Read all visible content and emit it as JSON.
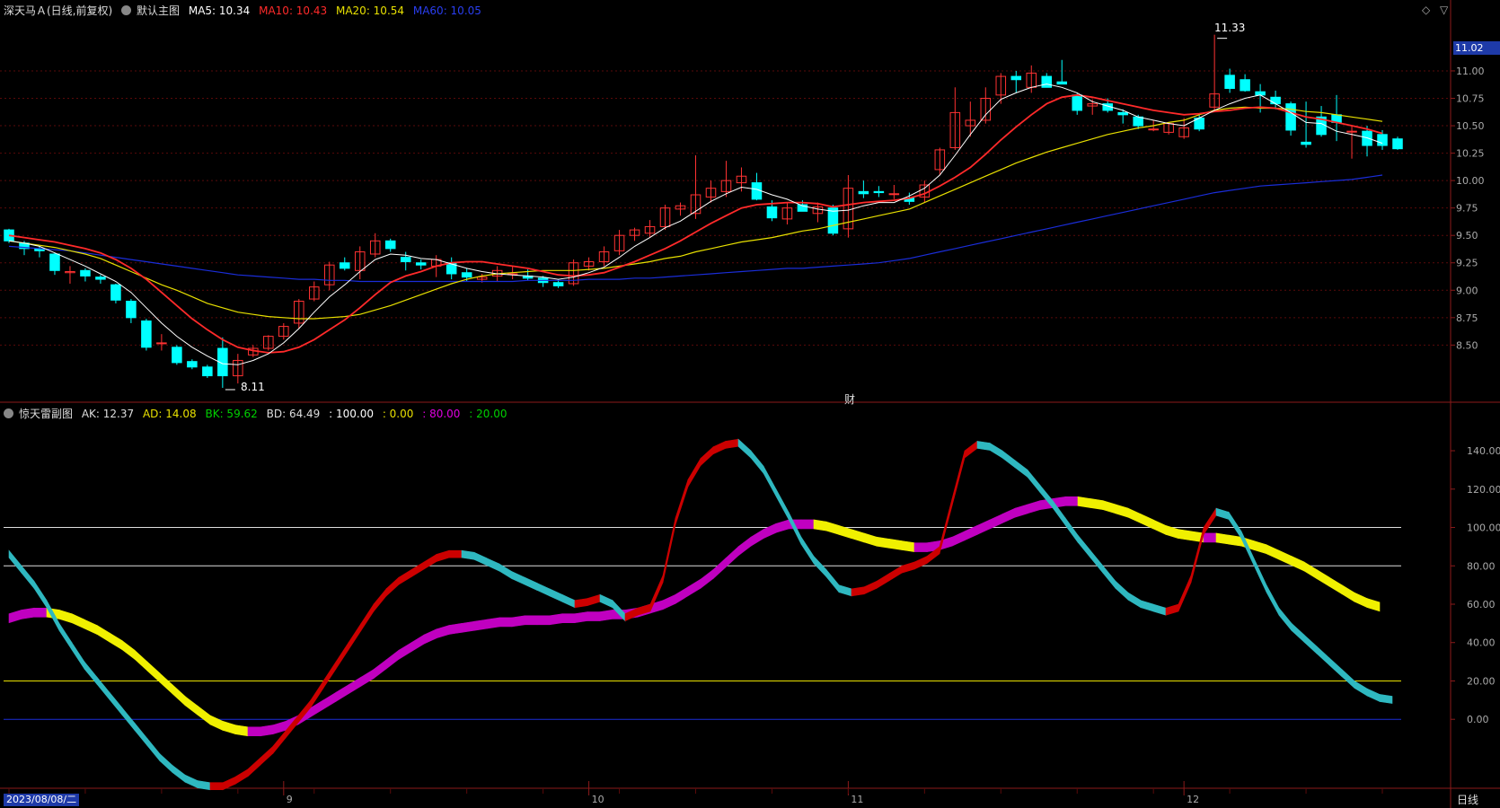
{
  "main_header": {
    "title": "深天马Ａ(日线,前复权)",
    "main_label": "默认主图",
    "ma5": "MA5: 10.34",
    "ma10": "MA10: 10.43",
    "ma20": "MA20: 10.54",
    "ma60": "MA60: 10.05"
  },
  "sub_header": {
    "title": "惊天雷副图",
    "ak": "AK: 12.37",
    "ad": "AD: 14.08",
    "bk": "BK: 59.62",
    "bd": "BD: 64.49",
    "l100": ": 100.00",
    "l0": ": 0.00",
    "l80": ": 80.00",
    "l20": ": 20.00"
  },
  "colors": {
    "up": "#ff3232",
    "down": "#00ffff",
    "ma5": "#ffffff",
    "ma10": "#ff2a2a",
    "ma20": "#e8e000",
    "ma60": "#1a2dd8",
    "ak_up": "#cc0000",
    "ak_down": "#2fb8c0",
    "ad_up": "#c000c0",
    "ad_down": "#f0f000"
  },
  "markers": {
    "high": "11.33",
    "low": "8.11",
    "fin": "财"
  },
  "price_tag": "11.02",
  "date_tag": "2023/08/08/二",
  "period_label": "日线",
  "window_controls": [
    "◇",
    "▽"
  ],
  "chart_data": [
    {
      "type": "candlestick",
      "y_ticks": [
        "11.00",
        "10.75",
        "10.50",
        "10.25",
        "10.00",
        "9.75",
        "9.50",
        "9.25",
        "9.00",
        "8.75",
        "8.50"
      ],
      "ylim": [
        8.11,
        11.45
      ],
      "x_ticks": [
        {
          "label": "9",
          "index": 18
        },
        {
          "label": "10",
          "index": 38
        },
        {
          "label": "11",
          "index": 55
        },
        {
          "label": "12",
          "index": 77
        }
      ],
      "ohlc": [
        [
          9.55,
          9.56,
          9.43,
          9.45
        ],
        [
          9.43,
          9.45,
          9.32,
          9.38
        ],
        [
          9.38,
          9.4,
          9.3,
          9.36
        ],
        [
          9.33,
          9.34,
          9.14,
          9.18
        ],
        [
          9.16,
          9.22,
          9.06,
          9.17
        ],
        [
          9.18,
          9.2,
          9.08,
          9.13
        ],
        [
          9.12,
          9.14,
          9.06,
          9.1
        ],
        [
          9.05,
          9.06,
          8.88,
          8.91
        ],
        [
          8.9,
          8.92,
          8.7,
          8.75
        ],
        [
          8.72,
          8.74,
          8.45,
          8.48
        ],
        [
          8.52,
          8.6,
          8.45,
          8.52
        ],
        [
          8.48,
          8.5,
          8.32,
          8.34
        ],
        [
          8.35,
          8.37,
          8.28,
          8.3
        ],
        [
          8.3,
          8.32,
          8.2,
          8.22
        ],
        [
          8.47,
          8.57,
          8.11,
          8.22
        ],
        [
          8.22,
          8.42,
          8.15,
          8.36
        ],
        [
          8.41,
          8.5,
          8.39,
          8.47
        ],
        [
          8.47,
          8.59,
          8.45,
          8.58
        ],
        [
          8.58,
          8.7,
          8.55,
          8.67
        ],
        [
          8.7,
          8.92,
          8.65,
          8.9
        ],
        [
          8.92,
          9.08,
          8.9,
          9.03
        ],
        [
          9.05,
          9.26,
          9.0,
          9.23
        ],
        [
          9.25,
          9.3,
          9.18,
          9.2
        ],
        [
          9.18,
          9.4,
          9.1,
          9.35
        ],
        [
          9.33,
          9.52,
          9.3,
          9.45
        ],
        [
          9.45,
          9.47,
          9.35,
          9.38
        ],
        [
          9.3,
          9.35,
          9.18,
          9.26
        ],
        [
          9.25,
          9.28,
          9.19,
          9.23
        ],
        [
          9.22,
          9.32,
          9.12,
          9.28
        ],
        [
          9.25,
          9.3,
          9.1,
          9.15
        ],
        [
          9.16,
          9.2,
          9.08,
          9.12
        ],
        [
          9.1,
          9.15,
          9.07,
          9.12
        ],
        [
          9.13,
          9.22,
          9.08,
          9.18
        ],
        [
          9.15,
          9.22,
          9.1,
          9.15
        ],
        [
          9.13,
          9.19,
          9.09,
          9.11
        ],
        [
          9.11,
          9.13,
          9.03,
          9.07
        ],
        [
          9.07,
          9.1,
          9.02,
          9.04
        ],
        [
          9.06,
          9.28,
          9.04,
          9.25
        ],
        [
          9.22,
          9.3,
          9.18,
          9.26
        ],
        [
          9.26,
          9.4,
          9.22,
          9.35
        ],
        [
          9.36,
          9.55,
          9.32,
          9.5
        ],
        [
          9.5,
          9.57,
          9.45,
          9.55
        ],
        [
          9.52,
          9.64,
          9.48,
          9.58
        ],
        [
          9.58,
          9.78,
          9.55,
          9.75
        ],
        [
          9.74,
          9.8,
          9.68,
          9.77
        ],
        [
          9.7,
          10.23,
          9.65,
          9.87
        ],
        [
          9.85,
          10.0,
          9.8,
          9.93
        ],
        [
          9.9,
          10.18,
          9.85,
          10.0
        ],
        [
          9.98,
          10.12,
          9.9,
          10.04
        ],
        [
          9.98,
          10.07,
          9.82,
          9.83
        ],
        [
          9.76,
          9.82,
          9.63,
          9.66
        ],
        [
          9.65,
          9.8,
          9.6,
          9.75
        ],
        [
          9.78,
          9.82,
          9.72,
          9.72
        ],
        [
          9.7,
          9.8,
          9.62,
          9.76
        ],
        [
          9.75,
          9.78,
          9.5,
          9.52
        ],
        [
          9.56,
          10.05,
          9.48,
          9.93
        ],
        [
          9.9,
          10.0,
          9.84,
          9.88
        ],
        [
          9.9,
          9.95,
          9.85,
          9.89
        ],
        [
          9.88,
          9.96,
          9.83,
          9.88
        ],
        [
          9.84,
          9.89,
          9.78,
          9.81
        ],
        [
          9.85,
          10.0,
          9.8,
          9.96
        ],
        [
          10.1,
          10.3,
          10.05,
          10.28
        ],
        [
          10.3,
          10.85,
          10.28,
          10.62
        ],
        [
          10.5,
          10.72,
          10.4,
          10.55
        ],
        [
          10.55,
          10.85,
          10.52,
          10.75
        ],
        [
          10.78,
          10.98,
          10.7,
          10.95
        ],
        [
          10.95,
          11.0,
          10.8,
          10.92
        ],
        [
          10.85,
          11.05,
          10.8,
          10.98
        ],
        [
          10.95,
          10.98,
          10.85,
          10.85
        ],
        [
          10.9,
          11.1,
          10.88,
          10.88
        ],
        [
          10.78,
          10.8,
          10.6,
          10.64
        ],
        [
          10.68,
          10.74,
          10.6,
          10.7
        ],
        [
          10.7,
          10.75,
          10.62,
          10.64
        ],
        [
          10.62,
          10.65,
          10.52,
          10.6
        ],
        [
          10.58,
          10.6,
          10.47,
          10.5
        ],
        [
          10.47,
          10.55,
          10.45,
          10.47
        ],
        [
          10.44,
          10.52,
          10.42,
          10.52
        ],
        [
          10.4,
          10.57,
          10.38,
          10.48
        ],
        [
          10.57,
          10.6,
          10.45,
          10.47
        ],
        [
          10.67,
          11.33,
          10.63,
          10.79
        ],
        [
          10.96,
          11.02,
          10.8,
          10.84
        ],
        [
          10.92,
          10.97,
          10.81,
          10.82
        ],
        [
          10.81,
          10.88,
          10.62,
          10.78
        ],
        [
          10.76,
          10.82,
          10.65,
          10.7
        ],
        [
          10.7,
          10.72,
          10.41,
          10.46
        ],
        [
          10.35,
          10.72,
          10.3,
          10.33
        ],
        [
          10.58,
          10.68,
          10.4,
          10.42
        ],
        [
          10.6,
          10.78,
          10.36,
          10.53
        ],
        [
          10.45,
          10.5,
          10.2,
          10.45
        ],
        [
          10.45,
          10.5,
          10.22,
          10.32
        ],
        [
          10.42,
          10.46,
          10.28,
          10.32
        ],
        [
          10.38,
          10.4,
          10.28,
          10.29
        ]
      ],
      "ma5": [
        9.45,
        9.43,
        9.4,
        9.34,
        9.28,
        9.22,
        9.15,
        9.08,
        8.98,
        8.84,
        8.7,
        8.58,
        8.48,
        8.4,
        8.33,
        8.32,
        8.36,
        8.42,
        8.52,
        8.65,
        8.8,
        8.94,
        9.05,
        9.17,
        9.28,
        9.33,
        9.32,
        9.29,
        9.28,
        9.24,
        9.2,
        9.17,
        9.15,
        9.14,
        9.13,
        9.12,
        9.1,
        9.12,
        9.16,
        9.21,
        9.3,
        9.4,
        9.48,
        9.57,
        9.63,
        9.72,
        9.81,
        9.88,
        9.94,
        9.92,
        9.87,
        9.83,
        9.77,
        9.74,
        9.72,
        9.73,
        9.77,
        9.8,
        9.8,
        9.86,
        9.93,
        10.05,
        10.23,
        10.42,
        10.6,
        10.74,
        10.8,
        10.85,
        10.88,
        10.85,
        10.8,
        10.72,
        10.68,
        10.64,
        10.58,
        10.55,
        10.52,
        10.5,
        10.57,
        10.64,
        10.7,
        10.75,
        10.78,
        10.7,
        10.62,
        10.53,
        10.52,
        10.45,
        10.42,
        10.39,
        10.34
      ],
      "ma10": [
        9.5,
        9.48,
        9.46,
        9.44,
        9.41,
        9.38,
        9.34,
        9.28,
        9.2,
        9.1,
        8.98,
        8.86,
        8.74,
        8.64,
        8.55,
        8.48,
        8.45,
        8.43,
        8.44,
        8.48,
        8.55,
        8.64,
        8.73,
        8.84,
        8.96,
        9.07,
        9.13,
        9.17,
        9.22,
        9.25,
        9.26,
        9.26,
        9.24,
        9.22,
        9.2,
        9.17,
        9.14,
        9.13,
        9.14,
        9.16,
        9.21,
        9.26,
        9.32,
        9.38,
        9.45,
        9.53,
        9.61,
        9.68,
        9.75,
        9.78,
        9.79,
        9.8,
        9.8,
        9.79,
        9.76,
        9.78,
        9.8,
        9.81,
        9.82,
        9.84,
        9.88,
        9.95,
        10.03,
        10.12,
        10.24,
        10.37,
        10.49,
        10.6,
        10.7,
        10.76,
        10.78,
        10.76,
        10.73,
        10.7,
        10.67,
        10.64,
        10.62,
        10.6,
        10.61,
        10.63,
        10.64,
        10.66,
        10.67,
        10.66,
        10.62,
        10.58,
        10.56,
        10.53,
        10.5,
        10.47,
        10.43
      ],
      "ma20": [
        9.45,
        9.43,
        9.41,
        9.39,
        9.36,
        9.33,
        9.29,
        9.23,
        9.17,
        9.11,
        9.05,
        9.0,
        8.94,
        8.88,
        8.84,
        8.8,
        8.78,
        8.76,
        8.75,
        8.74,
        8.74,
        8.75,
        8.76,
        8.78,
        8.82,
        8.86,
        8.91,
        8.96,
        9.01,
        9.06,
        9.1,
        9.13,
        9.15,
        9.16,
        9.17,
        9.18,
        9.18,
        9.18,
        9.19,
        9.2,
        9.22,
        9.24,
        9.26,
        9.29,
        9.31,
        9.35,
        9.38,
        9.41,
        9.44,
        9.46,
        9.48,
        9.51,
        9.54,
        9.56,
        9.59,
        9.62,
        9.65,
        9.68,
        9.71,
        9.74,
        9.8,
        9.86,
        9.92,
        9.98,
        10.04,
        10.1,
        10.16,
        10.21,
        10.26,
        10.3,
        10.34,
        10.38,
        10.42,
        10.45,
        10.48,
        10.5,
        10.53,
        10.55,
        10.6,
        10.64,
        10.66,
        10.67,
        10.66,
        10.66,
        10.65,
        10.63,
        10.62,
        10.6,
        10.58,
        10.56,
        10.54
      ],
      "ma60": [
        9.4,
        9.39,
        9.38,
        9.37,
        9.36,
        9.34,
        9.32,
        9.3,
        9.28,
        9.26,
        9.24,
        9.22,
        9.2,
        9.18,
        9.16,
        9.14,
        9.13,
        9.12,
        9.11,
        9.1,
        9.1,
        9.09,
        9.09,
        9.08,
        9.08,
        9.08,
        9.08,
        9.08,
        9.08,
        9.08,
        9.08,
        9.08,
        9.08,
        9.08,
        9.09,
        9.09,
        9.09,
        9.09,
        9.1,
        9.1,
        9.1,
        9.11,
        9.11,
        9.12,
        9.13,
        9.14,
        9.15,
        9.16,
        9.17,
        9.18,
        9.19,
        9.2,
        9.2,
        9.21,
        9.22,
        9.23,
        9.24,
        9.25,
        9.27,
        9.29,
        9.32,
        9.35,
        9.38,
        9.41,
        9.44,
        9.47,
        9.5,
        9.53,
        9.56,
        9.59,
        9.62,
        9.65,
        9.68,
        9.71,
        9.74,
        9.77,
        9.8,
        9.83,
        9.86,
        9.89,
        9.91,
        9.93,
        9.95,
        9.96,
        9.97,
        9.98,
        9.99,
        10.0,
        10.01,
        10.03,
        10.05
      ]
    },
    {
      "type": "oscillator",
      "y_ticks": [
        "140.00",
        "120.00",
        "100.00",
        "80.00",
        "60.00",
        "40.00",
        "20.00",
        "0.00"
      ],
      "ylim": [
        -35,
        155
      ],
      "reference_lines": [
        100,
        80,
        20,
        0
      ],
      "ak": [
        88,
        80,
        72,
        62,
        50,
        40,
        30,
        22,
        14,
        6,
        -2,
        -10,
        -18,
        -24,
        -29,
        -32,
        -33,
        -33,
        -30,
        -26,
        -20,
        -14,
        -6,
        2,
        10,
        20,
        30,
        40,
        50,
        60,
        68,
        74,
        78,
        82,
        86,
        88,
        88,
        87,
        84,
        81,
        77,
        74,
        71,
        68,
        65,
        62,
        63,
        65,
        62,
        55,
        58,
        60,
        75,
        105,
        125,
        136,
        142,
        145,
        146,
        140,
        132,
        120,
        108,
        95,
        85,
        78,
        70,
        68,
        69,
        72,
        76,
        80,
        82,
        85,
        90,
        115,
        140,
        145,
        144,
        140,
        135,
        130,
        122,
        114,
        105,
        96,
        88,
        80,
        72,
        66,
        62,
        60,
        58,
        60,
        75,
        100,
        110,
        108,
        98,
        84,
        70,
        58,
        50,
        44,
        38,
        32,
        26,
        20,
        16,
        13,
        12
      ],
      "ad": [
        55,
        57,
        58,
        58,
        57,
        55,
        52,
        49,
        45,
        41,
        36,
        30,
        24,
        18,
        12,
        7,
        2,
        -1,
        -3,
        -4,
        -4,
        -3,
        -1,
        2,
        6,
        10,
        14,
        18,
        22,
        26,
        31,
        36,
        40,
        44,
        47,
        49,
        50,
        51,
        52,
        53,
        53,
        54,
        54,
        54,
        55,
        55,
        56,
        56,
        57,
        57,
        58,
        60,
        62,
        65,
        69,
        73,
        78,
        84,
        90,
        95,
        99,
        102,
        104,
        104,
        104,
        103,
        101,
        99,
        97,
        95,
        94,
        93,
        92,
        92,
        93,
        95,
        98,
        101,
        104,
        107,
        110,
        112,
        114,
        115,
        116,
        116,
        115,
        114,
        112,
        110,
        107,
        104,
        101,
        99,
        98,
        97,
        97,
        96,
        95,
        93,
        91,
        88,
        85,
        82,
        78,
        74,
        70,
        66,
        63,
        61
      ],
      "ak_values_text": "AK: 12.37"
    }
  ]
}
